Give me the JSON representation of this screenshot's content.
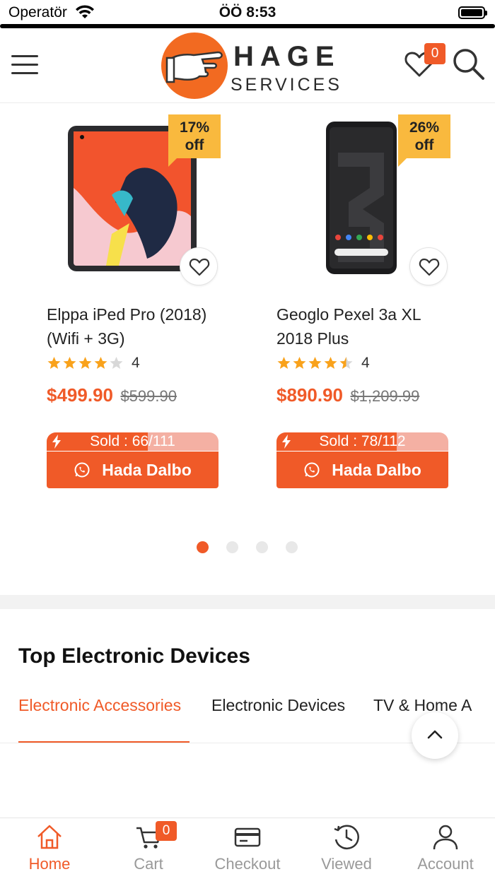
{
  "status_bar": {
    "carrier": "Operatör",
    "time": "ÖÖ 8:53"
  },
  "header": {
    "logo_line1": "HAGE",
    "logo_line2": "SERVICES",
    "wishlist_count": "0",
    "brand_color": "#f05a28"
  },
  "products": [
    {
      "discount_pct": "17%",
      "discount_suffix": "off",
      "title": "Elppa iPed Pro (2018) (Wifi + 3G)",
      "rating_count": "4",
      "rating_stars": 4,
      "price": "$499.90",
      "old_price": "$599.90",
      "sold_text": "Sold : 66/111",
      "sold_fraction": 0.59,
      "button_label": "Hada Dalbo",
      "image_icon": "tablet-image"
    },
    {
      "discount_pct": "26%",
      "discount_suffix": "off",
      "title": "Geoglo Pexel 3a XL 2018 Plus",
      "rating_count": "4",
      "rating_stars": 4.5,
      "price": "$890.90",
      "old_price": "$1,209.99",
      "sold_text": "Sold : 78/112",
      "sold_fraction": 0.7,
      "button_label": "Hada Dalbo",
      "image_icon": "phone-image"
    }
  ],
  "pagination": {
    "total": 4,
    "active_index": 0
  },
  "section": {
    "title": "Top Electronic Devices",
    "tabs": [
      {
        "label": "Electronic Accessories",
        "active": true
      },
      {
        "label": "Electronic Devices",
        "active": false
      },
      {
        "label": "TV & Home A",
        "active": false
      }
    ]
  },
  "bottom_nav": {
    "items": [
      {
        "label": "Home",
        "icon": "home-icon",
        "active": true
      },
      {
        "label": "Cart",
        "icon": "cart-icon",
        "active": false,
        "badge": "0"
      },
      {
        "label": "Checkout",
        "icon": "credit-card-icon",
        "active": false
      },
      {
        "label": "Viewed",
        "icon": "history-clock-icon",
        "active": false
      },
      {
        "label": "Account",
        "icon": "user-icon",
        "active": false
      }
    ]
  }
}
